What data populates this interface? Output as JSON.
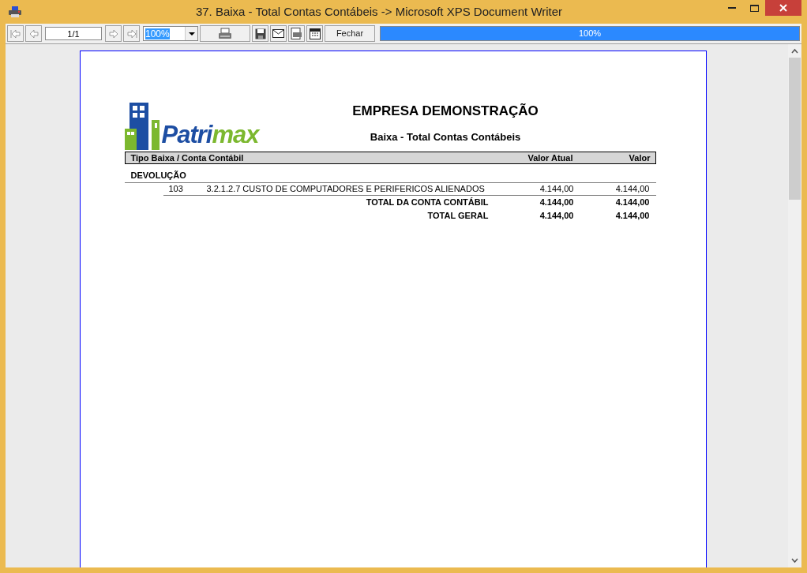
{
  "window": {
    "title": "37. Baixa - Total Contas Contábeis -> Microsoft XPS Document Writer"
  },
  "toolbar": {
    "page_field": "1/1",
    "zoom_field": "100%",
    "close_button": "Fechar",
    "progress": {
      "level": 1,
      "reading": "100%"
    }
  },
  "report": {
    "logo": [
      {
        "text": "Patri",
        "color": "#1d4ea3"
      },
      {
        "text": "max",
        "color": "#7cb82f"
      }
    ],
    "company": "EMPRESA DEMONSTRAÇÃO",
    "title": "Baixa - Total Contas Contábeis",
    "columns": [
      "Tipo Baixa / Conta Contábil",
      "Valor Atual",
      "Valor"
    ],
    "groups": [
      {
        "name": "DEVOLUÇÃO",
        "rows": [
          {
            "code": "103",
            "account": "3.2.1.2.7 CUSTO DE COMPUTADORES E PERIFERICOS ALIENADOS",
            "valor_atual": "4.144,00",
            "valor": "4.144,00"
          }
        ],
        "subtotal": {
          "label": "TOTAL DA CONTA CONTÁBIL",
          "valor_atual": "4.144,00",
          "valor": "4.144,00"
        }
      }
    ],
    "grand_total": {
      "label": "TOTAL GERAL",
      "valor_atual": "4.144,00",
      "valor": "4.144,00"
    }
  }
}
